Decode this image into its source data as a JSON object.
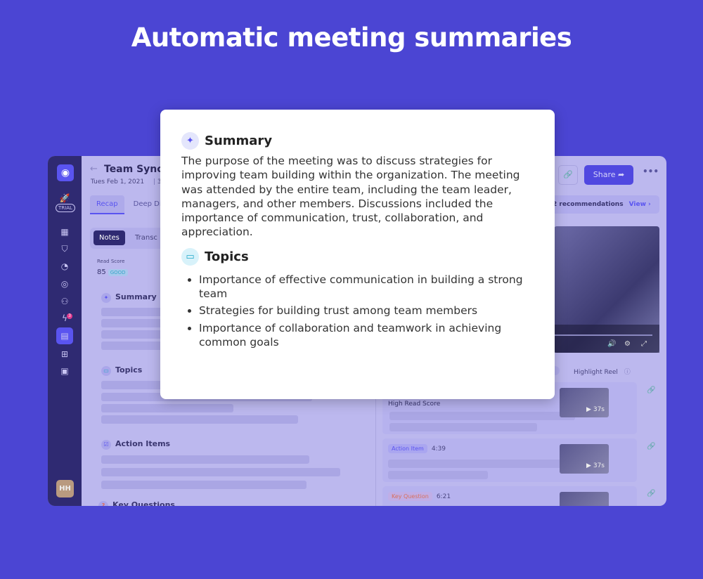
{
  "headline": "Automatic meeting summaries",
  "app": {
    "sidebar": {
      "trial_label": "TRIAL",
      "notification_count": "3",
      "avatar_initials": "HH",
      "icons": [
        "rocket-icon",
        "building-icon",
        "shield-icon",
        "pie-chart-icon",
        "target-icon",
        "users-icon",
        "lightning-icon",
        "document-icon",
        "add-chart-icon",
        "calendar-icon"
      ]
    },
    "header": {
      "back": "←",
      "title": "Team Sync",
      "date": "Tues Feb 1, 2021",
      "date_extra": "3",
      "share_label": "Share",
      "more": "•••"
    },
    "tabs": [
      "Recap",
      "Deep Di"
    ],
    "subtabs": [
      "Notes",
      "Transc"
    ],
    "read_score": {
      "label": "Read Score",
      "value": "85",
      "rating": "GOOD"
    },
    "sections": [
      "Summary",
      "Topics",
      "Action Items",
      "Key Questions"
    ],
    "recommendations": {
      "text": "2 recommendations",
      "view": "View"
    },
    "highlight_reel": "Highlight Reel",
    "moments": [
      {
        "title": "High Read Score",
        "duration": "37s"
      },
      {
        "tag": "Action Item",
        "time": "4:39",
        "duration": "37s"
      },
      {
        "tag": "Key Question",
        "time": "6:21"
      }
    ],
    "colors": {
      "accent": "#5a54f0",
      "background": "#4b45d3",
      "sidebar": "#2f2a72"
    }
  },
  "summary_card": {
    "summary_title": "Summary",
    "summary_text": "The purpose of the meeting was to discuss strategies for improving team building within the organization. The meeting was attended by the entire team, including the team leader, managers, and other members. Discussions  included the importance of communication, trust, collaboration, and appreciation.",
    "topics_title": "Topics",
    "topics": [
      "Importance of effective communication in building a strong team",
      "Strategies for building trust among team members",
      "Importance of collaboration and teamwork in achieving common goals"
    ]
  }
}
